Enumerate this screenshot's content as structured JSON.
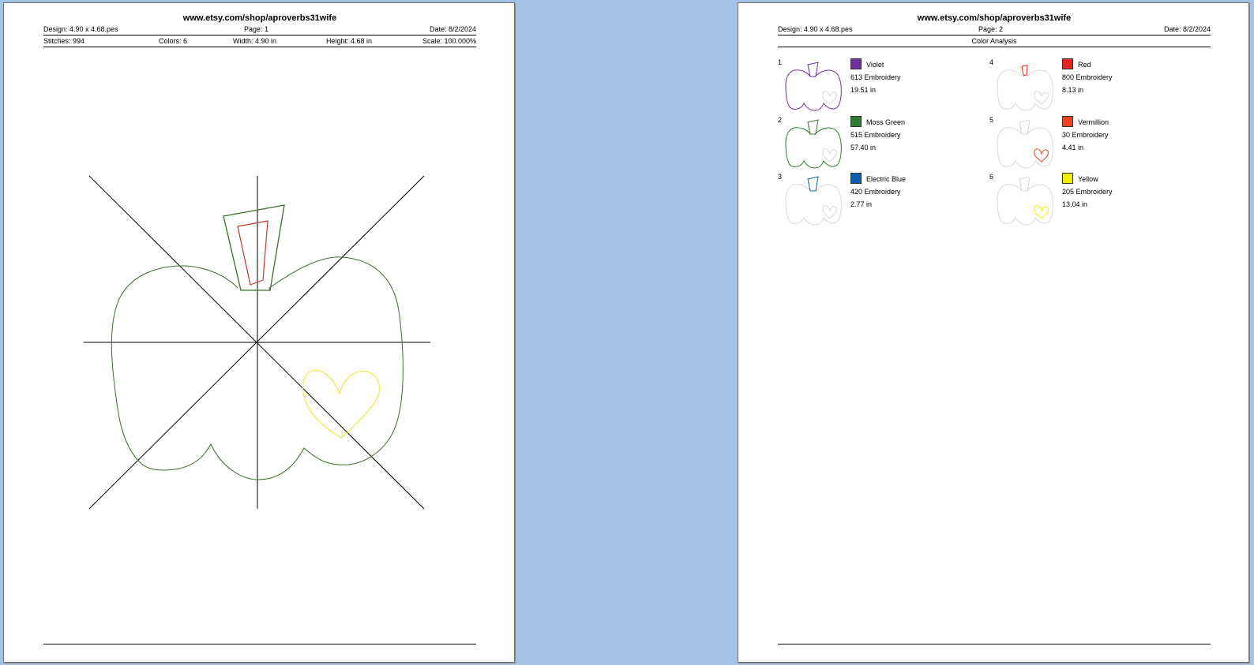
{
  "page1": {
    "site": "www.etsy.com/shop/aproverbs31wife",
    "design": "Design: 4.90 x 4.68.pes",
    "page": "Page: 1",
    "date": "Date: 8/2/2024",
    "stitches": "Stitches: 994",
    "colors": "Colors: 6",
    "width": "Width: 4.90 in",
    "height": "Height: 4.68 in",
    "scale": "Scale: 100.000%"
  },
  "page2": {
    "site": "www.etsy.com/shop/aproverbs31wife",
    "design": "Design: 4.90 x 4.68.pes",
    "page": "Page: 2",
    "date": "Date: 8/2/2024",
    "section": "Color Analysis"
  },
  "colors": [
    {
      "num": "1",
      "name": "Violet",
      "code": "613 Embroidery",
      "length": "19.51 in",
      "hex": "#7030a0",
      "part": "apple"
    },
    {
      "num": "2",
      "name": "Moss Green",
      "code": "515 Embroidery",
      "length": "57.40 in",
      "hex": "#2e7d32",
      "part": "apple"
    },
    {
      "num": "3",
      "name": "Electric Blue",
      "code": "420 Embroidery",
      "length": "2.77 in",
      "hex": "#0b5fad",
      "part": "stem"
    },
    {
      "num": "4",
      "name": "Red",
      "code": "800 Embroidery",
      "length": "8.13 in",
      "hex": "#e52222",
      "part": "stem"
    },
    {
      "num": "5",
      "name": "Vermillion",
      "code": "30 Embroidery",
      "length": "4.41 in",
      "hex": "#ee4422",
      "part": "heart"
    },
    {
      "num": "6",
      "name": "Yellow",
      "code": "205 Embroidery",
      "length": "13.04 in",
      "hex": "#f5f000",
      "part": "heart"
    }
  ],
  "stitch_colors": {
    "outline": "#3d6b2c",
    "stem_outer": "#3d6b2c",
    "stem_inner": "#c0392b",
    "heart": "#eeea40",
    "faint": "#d8d8d8"
  }
}
